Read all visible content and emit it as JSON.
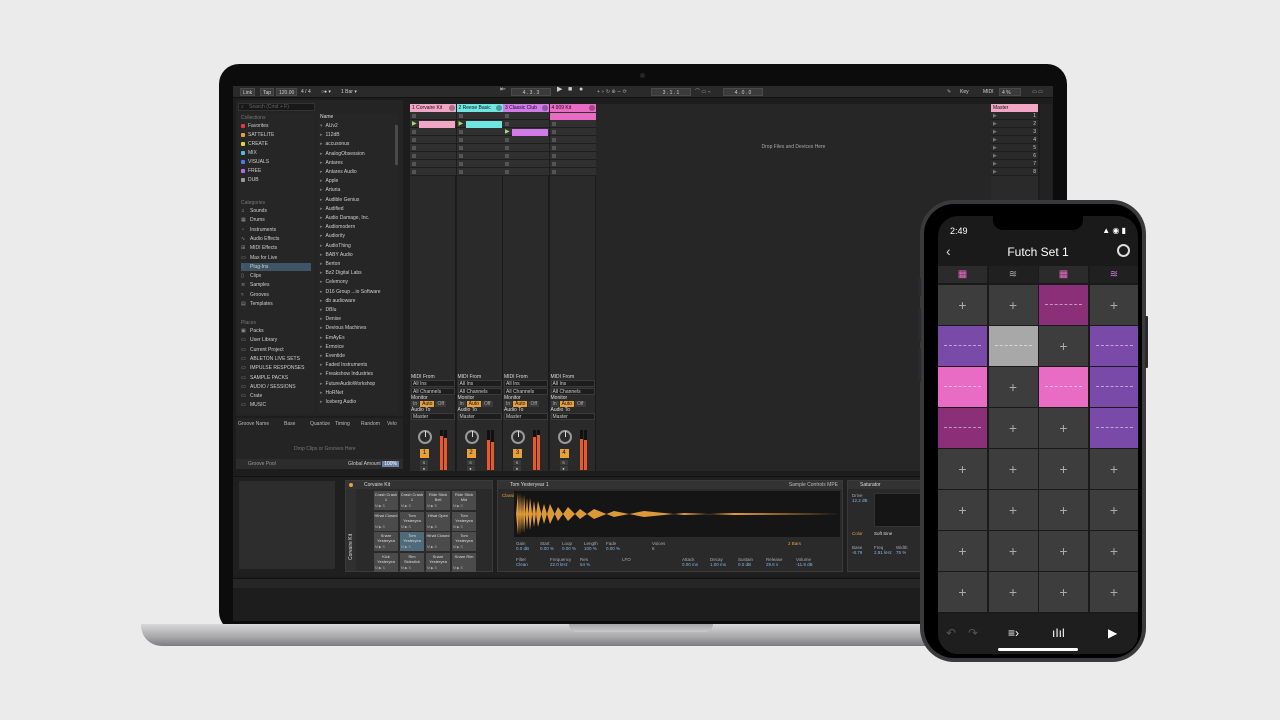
{
  "colors": {
    "pink": "#f2a6c6",
    "cyan": "#6ee7e3",
    "magenta": "#d17ae8",
    "hotpink": "#e86cc4",
    "orange": "#e8a03a",
    "purple": "#7a4aa8",
    "darkmagenta": "#8a2f78",
    "lightgray": "#a8a8a8"
  },
  "ableton": {
    "toolbar": {
      "link": "Link",
      "tap": "Tap",
      "tempo": "120.00",
      "sig": "4 / 4",
      "metro": "○● ▾",
      "quant": "1 Bar ▾",
      "arrpos": "4 . 3 . 3",
      "play": "▶",
      "stop": "■",
      "rec": "●",
      "loop": "3 . 1 . 1",
      "len": "4 . 0 . 0",
      "key": "Key",
      "midi": "MIDI",
      "cpu": "4 %"
    },
    "browser": {
      "search_placeholder": "Search (Cmd + F)",
      "collections_h": "Collections",
      "collections": [
        {
          "label": "Favorites",
          "color": "#e23a3a"
        },
        {
          "label": "SATTELITE",
          "color": "#e8a03a"
        },
        {
          "label": "CREATE",
          "color": "#e8d23a"
        },
        {
          "label": "MIX",
          "color": "#4ac0e0"
        },
        {
          "label": "VISUALS",
          "color": "#4a7ae8"
        },
        {
          "label": "FREE",
          "color": "#b46ae8"
        },
        {
          "label": "DUB",
          "color": "#999999"
        }
      ],
      "categories_h": "Categories",
      "categories": [
        {
          "label": "Sounds",
          "icon": "♫"
        },
        {
          "label": "Drums",
          "icon": "▦"
        },
        {
          "label": "Instruments",
          "icon": "◔"
        },
        {
          "label": "Audio Effects",
          "icon": "∿"
        },
        {
          "label": "MIDI Effects",
          "icon": "⊞"
        },
        {
          "label": "Max for Live",
          "icon": "▭"
        },
        {
          "label": "Plug-Ins",
          "icon": "◌",
          "selected": true
        },
        {
          "label": "Clips",
          "icon": "▯"
        },
        {
          "label": "Samples",
          "icon": "≋"
        },
        {
          "label": "Grooves",
          "icon": "≈"
        },
        {
          "label": "Templates",
          "icon": "▤"
        }
      ],
      "places_h": "Places",
      "places": [
        {
          "label": "Packs",
          "icon": "▣"
        },
        {
          "label": "User Library",
          "icon": "▭"
        },
        {
          "label": "Current Project",
          "icon": "▭"
        },
        {
          "label": "ABLETON LIVE SETS",
          "icon": "▭"
        },
        {
          "label": "IMPULSE RESPONSES",
          "icon": "▭"
        },
        {
          "label": "SAMPLE PACKS",
          "icon": "▭"
        },
        {
          "label": "AUDIO / SESSIONS",
          "icon": "▭"
        },
        {
          "label": "Crate",
          "icon": "▭"
        },
        {
          "label": "MUSIC",
          "icon": "▭"
        }
      ],
      "name_h": "Name",
      "names": [
        "AUv2",
        "112dB",
        "accusonus",
        "AnalogObsession",
        "Antares",
        "Antares Audio",
        "Apple",
        "Arturia",
        "Audible Genius",
        "Audified",
        "Audio Damage, Inc.",
        "Audiomodern",
        "Audiority",
        "AudioThing",
        "BABY Audio",
        "Berton",
        "Bz2 Digital Labs",
        "Celemony",
        "D16 Group ...io Software",
        "db audioware",
        "DBlu",
        "Denise",
        "Devious Machines",
        "EmAyEs",
        "Ermoice",
        "Eventide",
        "Faded Instruments",
        "Freakshow Industries",
        "FutureAudioWorkshop",
        "HoRNet",
        "Iceberg Audio"
      ]
    },
    "groove": {
      "cols": [
        "Groove Name",
        "Base",
        "Quantize",
        "Timing",
        "Random",
        "Velo"
      ],
      "pool": "Groove Pool",
      "amount_label": "Global Amount",
      "amount": "100%",
      "drop": "Drop Clips or Grooves Here"
    },
    "tracks": [
      {
        "name": "1 Corvaire Kit",
        "color": "#f2a6c6",
        "num": "1",
        "knob_label": "S"
      },
      {
        "name": "2 Reese Basic",
        "color": "#6ee7e3",
        "num": "2",
        "knob_label": "S"
      },
      {
        "name": "3 Classic Club",
        "color": "#d17ae8",
        "num": "3",
        "knob_label": "S"
      },
      {
        "name": "4 909 Kit",
        "color": "#e86cc4",
        "num": "4",
        "knob_label": "S"
      }
    ],
    "io": {
      "midi_from": "MIDI From",
      "all_ins": "All Ins",
      "all_channels": "All Channels",
      "monitor": "Monitor",
      "in": "In",
      "auto": "Auto",
      "off": "Off",
      "audio_to": "Audio To",
      "master": "Master"
    },
    "drop_text": "Drop Files and Devices Here",
    "master": {
      "name": "Master",
      "scenes": [
        "1",
        "2",
        "3",
        "4",
        "5",
        "6",
        "7",
        "8"
      ]
    },
    "devices": {
      "rack_name": "Corvaire Kit",
      "pads": [
        [
          "Crash Crash 1",
          "Crash Crash 1",
          "Ride Stick Bell",
          "Ride Stick Mid"
        ],
        [
          "Hihat Closed",
          "Tom Yesteryea",
          "Hihat Open",
          "Tom Yesteryea"
        ],
        [
          "Snare Yesteryea",
          "Tom Yesteryea",
          "Hihat Closed",
          "Tom Yesteryea"
        ],
        [
          "Kick Yesteryea",
          "Rim Sidestick",
          "Snare Yesteryea",
          "Snare Rim"
        ]
      ],
      "sampler_name": "Tom Yesteryear 1",
      "sampler_tabs": "Sample   Controls   MPE",
      "classic": "Classic",
      "params": {
        "gain": "0.0 dB",
        "start": "0.00 %",
        "loop": "0.00 %",
        "length": "100 %",
        "fade": "0.00 %",
        "voices": "6",
        "filter": "Filter",
        "clean": "Clean",
        "freq": "22.0 kHz",
        "res": "54 %",
        "lfo": "LFO",
        "attack": "0.00 ms",
        "decay": "1.00 ms",
        "sustain": "0.0 dB",
        "release": "29.6 s",
        "volume": "-11.9 dB",
        "bars": "2 Bars"
      },
      "saturator_name": "Saturator",
      "drive": "12.2 dB",
      "soft_sine": "Soft Sine",
      "color": "Color",
      "base": "-8.79",
      "freq": "2.81 kHz",
      "width": "75 %"
    }
  },
  "phone": {
    "time": "2:49",
    "status": "▲ ◉ ▮",
    "title": "Futch Set 1",
    "tabs": [
      "▦",
      "≋",
      "▦",
      "≋"
    ],
    "cells": [
      [
        "empty",
        "empty",
        "darkmagenta",
        "empty"
      ],
      [
        "purple",
        "lightgray",
        "empty",
        "purple"
      ],
      [
        "hotpink",
        "empty",
        "hotpink",
        "purple"
      ],
      [
        "darkmagenta",
        "empty",
        "empty",
        "purple"
      ],
      [
        "empty",
        "empty",
        "empty",
        "empty"
      ],
      [
        "empty",
        "empty",
        "empty",
        "empty"
      ],
      [
        "empty",
        "empty",
        "empty",
        "empty"
      ],
      [
        "empty",
        "empty",
        "empty",
        "empty"
      ]
    ],
    "plus": "+",
    "controls": {
      "undo": "↶",
      "redo": "↷",
      "scenes": "≡›",
      "mixer": "ıIıl",
      "play": "▶"
    }
  }
}
